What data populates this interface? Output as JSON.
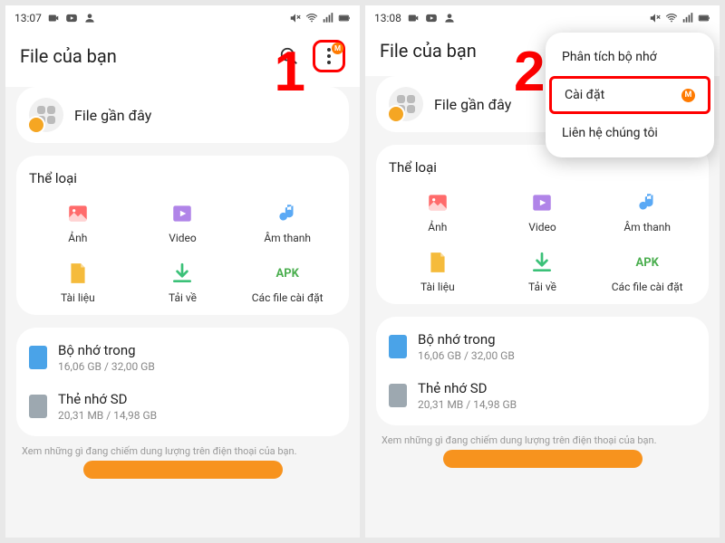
{
  "left": {
    "time": "13:07",
    "step": "1"
  },
  "right": {
    "time": "13:08",
    "step": "2"
  },
  "header": {
    "title": "File của bạn"
  },
  "recent": {
    "label": "File gần đây"
  },
  "categories": {
    "title": "Thể loại",
    "items": [
      {
        "label": "Ảnh"
      },
      {
        "label": "Video"
      },
      {
        "label": "Âm thanh"
      },
      {
        "label": "Tài liệu"
      },
      {
        "label": "Tải về"
      },
      {
        "label": "Các file cài đặt"
      }
    ]
  },
  "storage": {
    "internal": {
      "title": "Bộ nhớ trong",
      "sub": "16,06 GB / 32,00 GB"
    },
    "sd": {
      "title": "Thẻ nhớ SD",
      "sub": "20,31 MB / 14,98 GB"
    }
  },
  "footer": "Xem những gì đang chiếm dung lượng trên điện thoại của bạn.",
  "menu": {
    "analyze": "Phân tích bộ nhớ",
    "settings": "Cài đặt",
    "contact": "Liên hệ chúng tôi",
    "badge": "M"
  },
  "badge": "M"
}
